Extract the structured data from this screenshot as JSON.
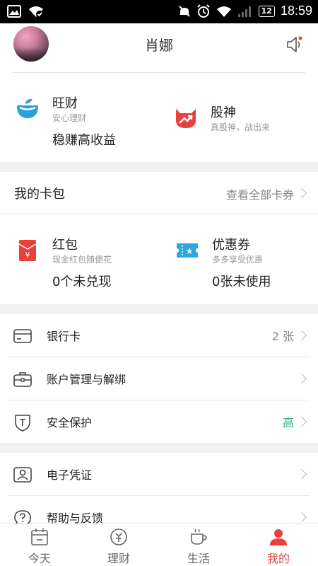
{
  "status_bar": {
    "time": "18:59",
    "battery": "12"
  },
  "header": {
    "title": "肖娜"
  },
  "products": [
    {
      "name": "旺财",
      "sub": "安心理财",
      "value": "稳赚高收益",
      "icon": "wangcai-icon"
    },
    {
      "name": "股神",
      "sub": "真股神，战出来",
      "icon": "gushen-icon"
    }
  ],
  "wallet": {
    "title": "我的卡包",
    "more": "查看全部卡券",
    "items": [
      {
        "name": "红包",
        "sub": "现金红包随便花",
        "value": "0个未兑现",
        "icon": "red-envelope-icon"
      },
      {
        "name": "优惠券",
        "sub": "多多享受优惠",
        "value": "0张未使用",
        "icon": "coupon-icon"
      }
    ]
  },
  "menu1": [
    {
      "label": "银行卡",
      "value": "2 张",
      "icon": "bank-card-icon"
    },
    {
      "label": "账户管理与解绑",
      "value": "",
      "icon": "briefcase-icon"
    },
    {
      "label": "安全保护",
      "value": "高",
      "icon": "shield-icon"
    }
  ],
  "menu2": [
    {
      "label": "电子凭证",
      "icon": "id-card-icon"
    },
    {
      "label": "帮助与反馈",
      "icon": "help-icon"
    }
  ],
  "tabs": [
    {
      "label": "今天",
      "icon": "calendar-icon"
    },
    {
      "label": "理财",
      "icon": "finance-icon"
    },
    {
      "label": "生活",
      "icon": "coffee-icon"
    },
    {
      "label": "我的",
      "icon": "user-icon",
      "active": true
    }
  ],
  "colors": {
    "accent_red": "#e8413c",
    "safe_green": "#2bb673",
    "wangcai_blue": "#2aa0dc",
    "coupon_blue": "#2ea6e0"
  }
}
